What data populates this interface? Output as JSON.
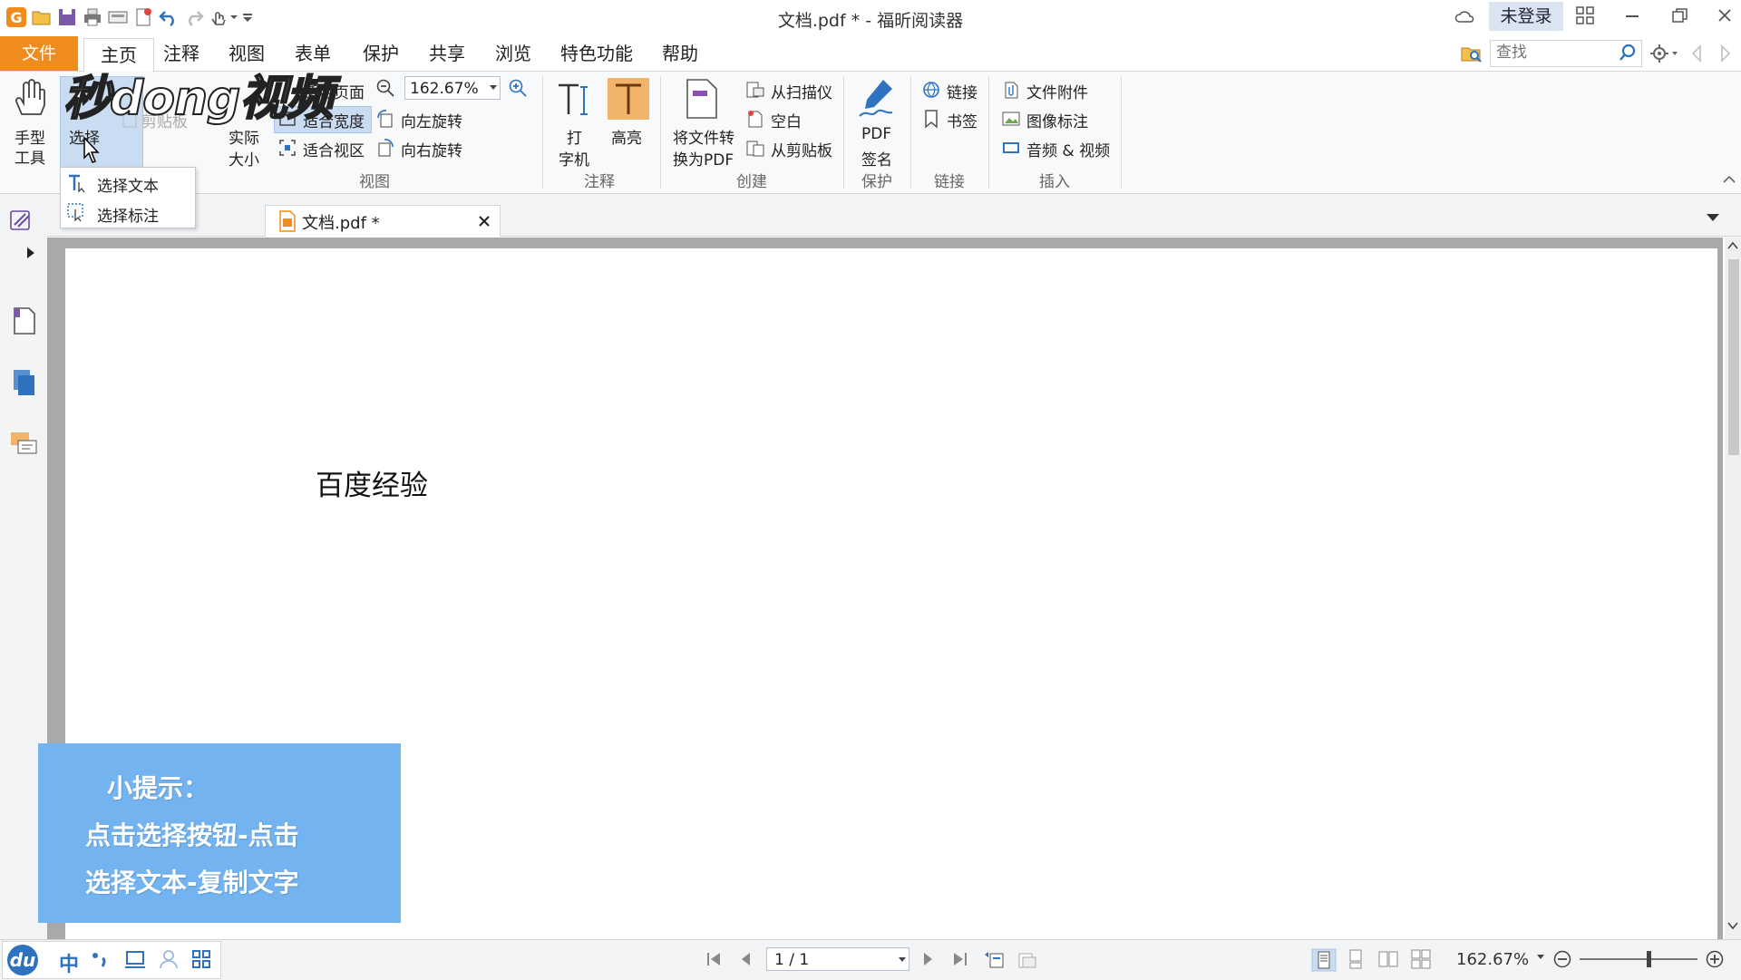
{
  "window": {
    "title": "文档.pdf * - 福昕阅读器",
    "login_label": "未登录"
  },
  "menu": {
    "file": "文件",
    "tabs": [
      "主页",
      "注释",
      "视图",
      "表单",
      "保护",
      "共享",
      "浏览",
      "特色功能",
      "帮助"
    ],
    "search_placeholder": "查找"
  },
  "ribbon": {
    "hand_tool": [
      "手型",
      "工具"
    ],
    "select": "选择",
    "clipboard": "剪贴板",
    "fit_page": "适合页面",
    "fit_width": "适合宽度",
    "fit_view": "适合视区",
    "actual_size": [
      "实际",
      "大小"
    ],
    "zoom_value": "162.67%",
    "rotate_left": "向左旋转",
    "rotate_right": "向右旋转",
    "view_group": "视图",
    "typewriter": [
      "打",
      "字机"
    ],
    "highlight": "高亮",
    "annotation_group": "注释",
    "convert_to_pdf": [
      "将文件转",
      "换为PDF"
    ],
    "from_scanner": "从扫描仪",
    "blank": "空白",
    "from_clipboard": "从剪贴板",
    "create_group": "创建",
    "pdf_sign": [
      "PDF",
      "签名"
    ],
    "protect_group": "保护",
    "link": "链接",
    "bookmark": "书签",
    "link_group": "链接",
    "file_attachment": "文件附件",
    "image_annotation": "图像标注",
    "audio_video": "音频 & 视频",
    "insert_group": "插入"
  },
  "dropdown": {
    "select_text": "选择文本",
    "select_annotation": "选择标注"
  },
  "tabs": {
    "document_tab": "文档.pdf *"
  },
  "document": {
    "text": "百度经验"
  },
  "tip": {
    "line1": "小提示：",
    "line2": "点击选择按钮-点击",
    "line3": "选择文本-复制文字"
  },
  "status": {
    "page_indicator": "1 / 1",
    "zoom": "162.67%"
  },
  "ime": {
    "chinese": "中"
  },
  "watermark": {
    "text": "秒dong视频"
  },
  "colors": {
    "file_tab": "#f08c1e",
    "tip_box": "#73b3f0",
    "select_highlight": "#c9dcf2",
    "highlight_tool": "#f2b46a",
    "accent_blue": "#2e72c0"
  }
}
